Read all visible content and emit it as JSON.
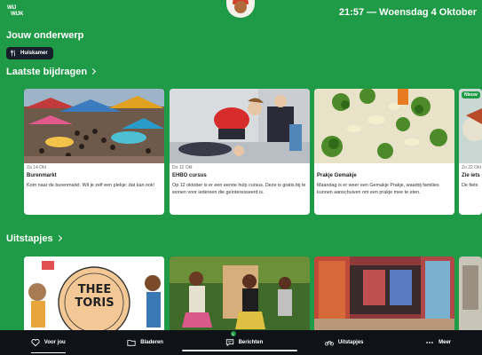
{
  "app": {
    "logo_text_1": "WIJ",
    "logo_text_2": "WIJK"
  },
  "header": {
    "clock": "21:57 — Woensdag 4 Oktober"
  },
  "topic": {
    "title": "Jouw onderwerp",
    "chip_label": "Huiskamer"
  },
  "latest": {
    "title": "Laatste bijdragen",
    "cards": [
      {
        "date": "Za 14 Okt",
        "title": "Burenmarkt",
        "desc": "Kom naar de burenmarkt. Wil je zelf een plekje: dat kan ook!"
      },
      {
        "date": "Do 12 Okt",
        "title": "EHBO cursus",
        "desc": "Op 12 oktober is er een eerste hulp cursus. Deze is gratis bij te wonen voor iedereen die geïnteresseerd is."
      },
      {
        "date": "",
        "title": "Prakje Gemakje",
        "desc": "Maandag is er weer een Gemakje Prakje, waarbij families kunnen aanschuiven om een prakje mee te eten."
      },
      {
        "date": "Zo 22 Okt",
        "title": "Zie iets",
        "desc": "De fiets",
        "badge": "Nieuw"
      }
    ]
  },
  "trips": {
    "title": "Uitstapjes",
    "items": [
      {
        "text_1": "THEE",
        "text_2": "TORIS"
      }
    ]
  },
  "nav": {
    "items": [
      {
        "label": "Voor jou",
        "icon": "heart-icon"
      },
      {
        "label": "Bladeren",
        "icon": "folder-icon"
      },
      {
        "label": "Berichten",
        "icon": "chat-icon",
        "badge": "1"
      },
      {
        "label": "Uitstapjes",
        "icon": "bike-icon"
      },
      {
        "label": "Meer",
        "icon": "more-icon"
      }
    ]
  }
}
